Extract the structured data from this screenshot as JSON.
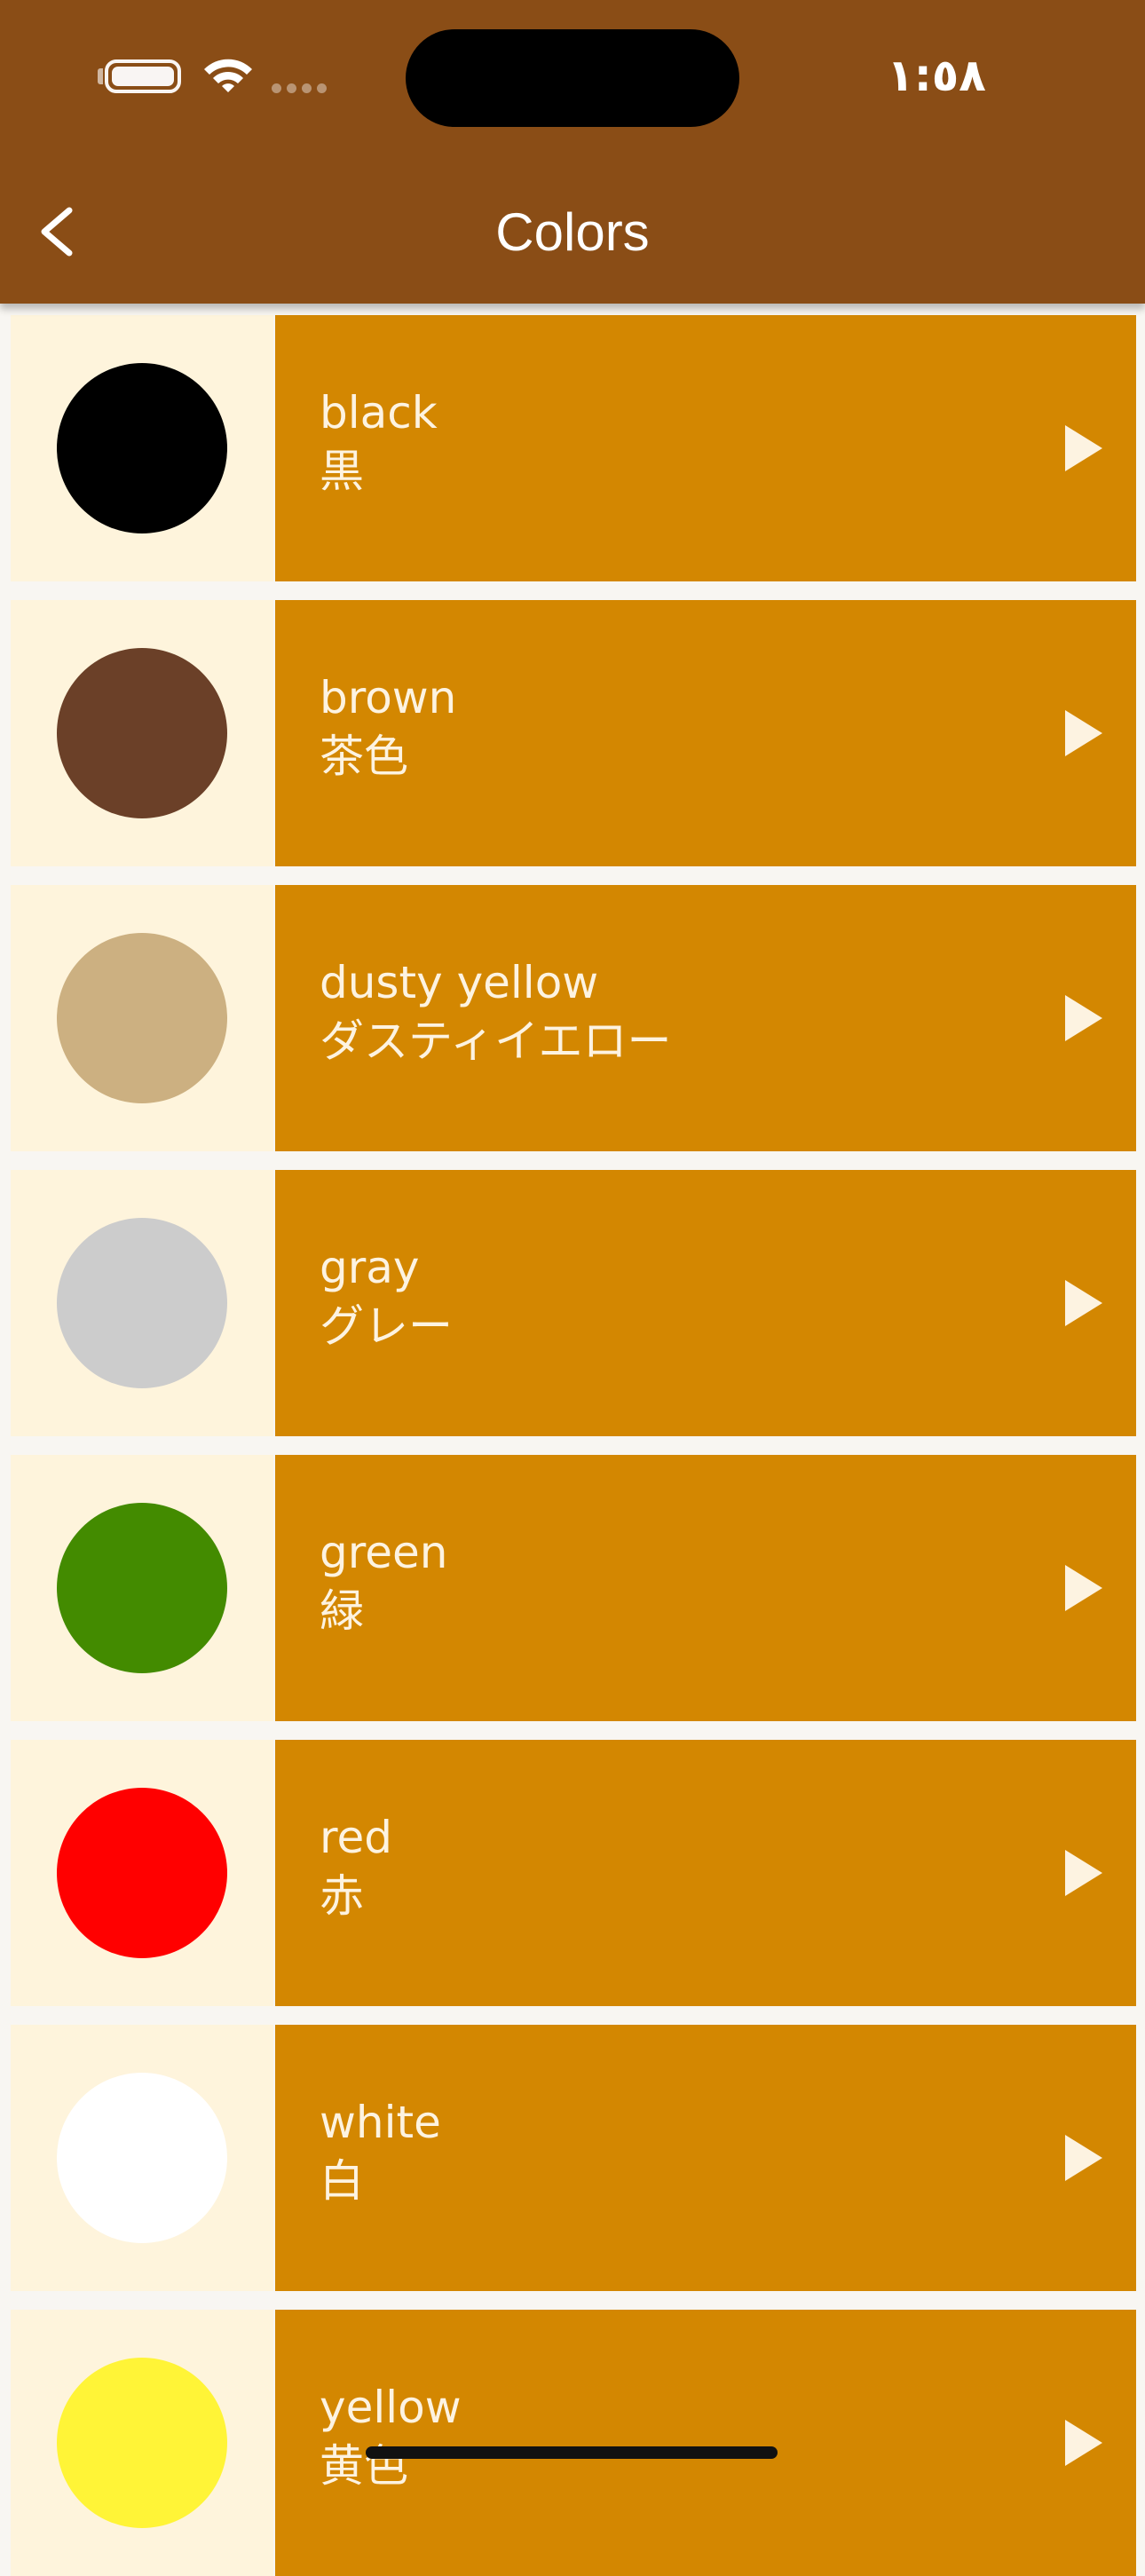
{
  "status_bar": {
    "time": "١:٥٨",
    "battery_icon": "battery-icon",
    "wifi_icon": "wifi-icon"
  },
  "header": {
    "title": "Colors",
    "back_icon": "chevron-left-icon",
    "background": "#8a4d16"
  },
  "theme": {
    "swatch_panel_color": "#fef4dc",
    "label_panel_color": "#d38701",
    "text_color": "#fdf3e1"
  },
  "items": [
    {
      "english": "black",
      "japanese": "黒",
      "swatch": "#000000",
      "icon": "play-icon"
    },
    {
      "english": "brown",
      "japanese": "茶色",
      "swatch": "#6b4028",
      "icon": "play-icon"
    },
    {
      "english": "dusty yellow",
      "japanese": "ダスティイエロー",
      "swatch": "#ccb081",
      "icon": "play-icon"
    },
    {
      "english": "gray",
      "japanese": "グレー",
      "swatch": "#cccccc",
      "icon": "play-icon"
    },
    {
      "english": "green",
      "japanese": "緑",
      "swatch": "#438b00",
      "icon": "play-icon"
    },
    {
      "english": "red",
      "japanese": "赤",
      "swatch": "#ff0000",
      "icon": "play-icon"
    },
    {
      "english": "white",
      "japanese": "白",
      "swatch": "#ffffff",
      "icon": "play-icon"
    },
    {
      "english": "yellow",
      "japanese": "黄色",
      "swatch": "#fff437",
      "icon": "play-icon"
    }
  ]
}
